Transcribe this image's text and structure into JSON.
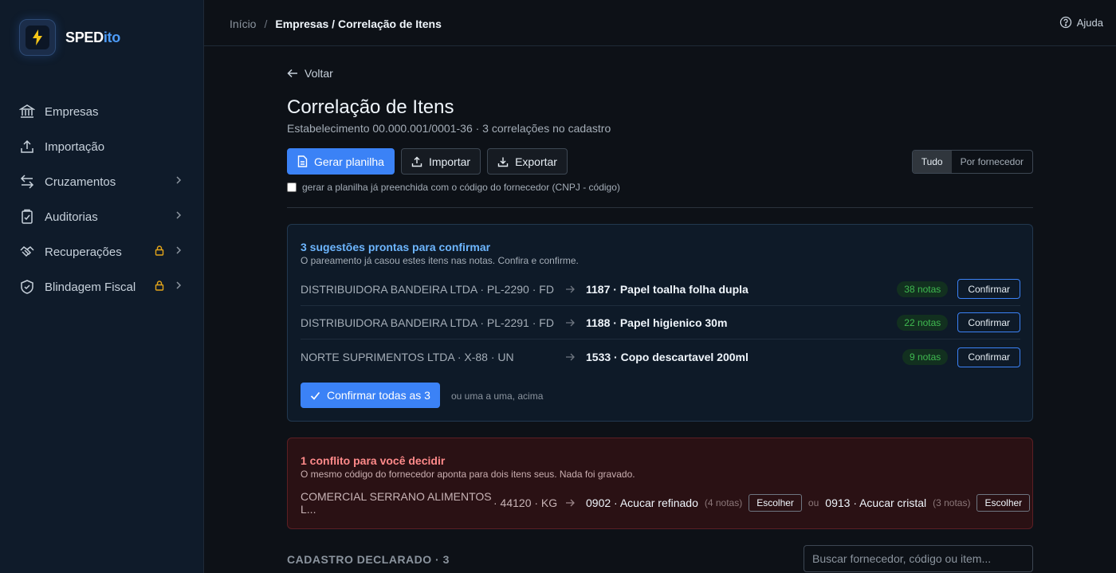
{
  "app": {
    "name_main": "SPED",
    "name_accent": "ito"
  },
  "sidebar": {
    "items": [
      {
        "label": "Empresas"
      },
      {
        "label": "Importação"
      },
      {
        "label": "Cruzamentos"
      },
      {
        "label": "Auditorias"
      },
      {
        "label": "Recuperações"
      },
      {
        "label": "Blindagem Fiscal"
      }
    ]
  },
  "breadcrumb": {
    "home": "Início",
    "separator": "/",
    "current": "Empresas / Correlação de Itens"
  },
  "header": {
    "help": "Ajuda"
  },
  "page": {
    "back": "Voltar",
    "title": "Correlação de Itens",
    "subtitle": "Estabelecimento 00.000.001/0001-36 · 3 correlações no cadastro"
  },
  "toolbar": {
    "generate": "Gerar planilha",
    "import": "Importar",
    "export": "Exportar",
    "checkbox_label": "gerar a planilha já preenchida com o código do fornecedor (CNPJ - código)",
    "checkbox_checked": false,
    "view_all": "Tudo",
    "view_supplier": "Por fornecedor"
  },
  "suggestions": {
    "title": "3 sugestões prontas para confirmar",
    "subtitle": "O pareamento já casou estes itens nas notas. Confira e confirme.",
    "rows": [
      {
        "source": "DISTRIBUIDORA BANDEIRA LTDA · PL-2290 · FD",
        "target": "1187 · Papel toalha folha dupla",
        "badge": "38 notas",
        "action": "Confirmar"
      },
      {
        "source": "DISTRIBUIDORA BANDEIRA LTDA · PL-2291 · FD",
        "target": "1188 · Papel higienico 30m",
        "badge": "22 notas",
        "action": "Confirmar"
      },
      {
        "source": "NORTE SUPRIMENTOS LTDA · X-88 · UN",
        "target": "1533 · Copo descartavel 200ml",
        "badge": "9 notas",
        "action": "Confirmar"
      }
    ],
    "confirm_all": "Confirmar todas as 3",
    "confirm_note": "ou uma a uma, acima"
  },
  "conflict": {
    "title": "1 conflito para você decidir",
    "subtitle": "O mesmo código do fornecedor aponta para dois itens seus. Nada foi gravado.",
    "source": "COMERCIAL SERRANO ALIMENTOS L...",
    "code": "· 44120 · KG",
    "option1": "0902 · Acucar refinado",
    "option1_count": "(4 notas)",
    "option2": "0913 · Acucar cristal",
    "option2_count": "(3 notas)",
    "choose": "Escolher",
    "or": "ou"
  },
  "cadastro": {
    "label": "CADASTRO DECLARADO · 3",
    "search_placeholder": "Buscar fornecedor, código ou item..."
  },
  "colors": {
    "accent": "#3b82f6",
    "success": "#3fb950",
    "danger": "#ff8a8a",
    "lock": "#e3a51a"
  },
  "icons": [
    "bolt-icon",
    "bank-icon",
    "upload-icon",
    "swap-icon",
    "clipboard-check-icon",
    "handshake-icon",
    "shield-icon",
    "lock-icon",
    "chevron-right-icon",
    "help-circle-icon",
    "arrow-left-icon",
    "file-icon",
    "download-icon",
    "arrow-right-icon",
    "check-icon"
  ]
}
